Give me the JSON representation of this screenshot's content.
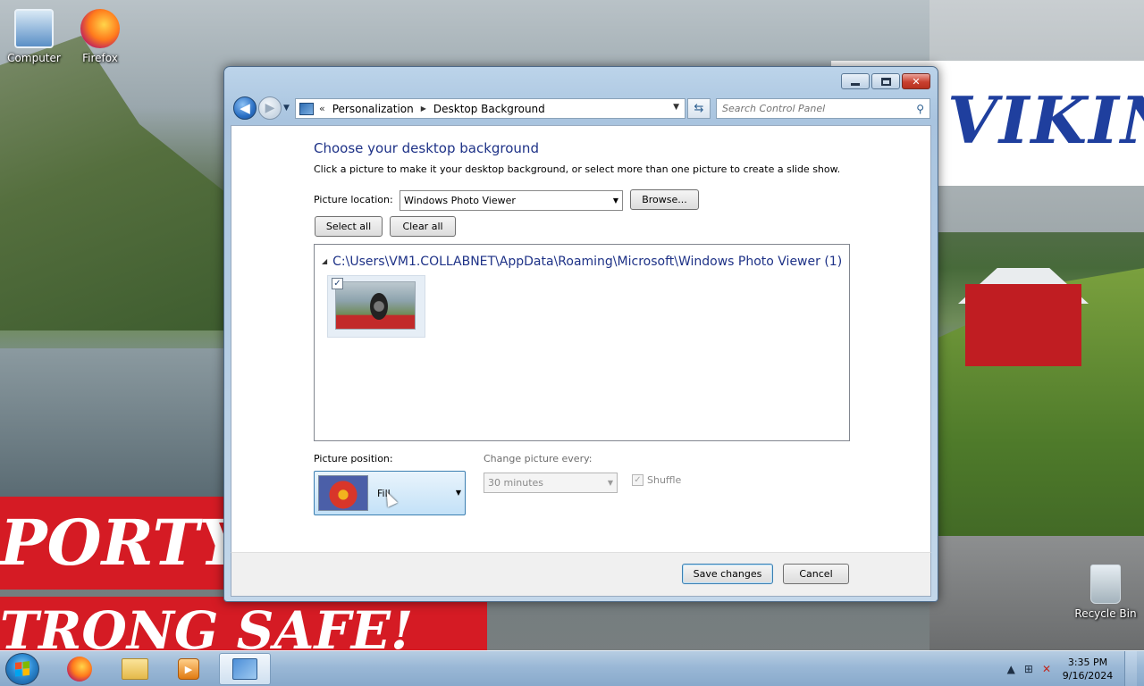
{
  "desktop": {
    "icons": [
      {
        "label": "Computer"
      },
      {
        "label": "Firefox"
      },
      {
        "label": "Recycle Bin"
      }
    ],
    "wallpaper_text": {
      "brand": "VIKING",
      "banner_line_1": "PORTY",
      "banner_line_2": "TRONG  SAFE!"
    }
  },
  "window": {
    "controls": {
      "minimize": "minimize",
      "maximize": "maximize",
      "close": "✕"
    },
    "nav": {
      "back_glyph": "◀",
      "forward_glyph": "▶",
      "recent_glyph": "▼",
      "address_sep": "«",
      "breadcrumbs": [
        "Personalization",
        "Desktop Background"
      ],
      "crumb_arrow": "▶",
      "address_dropdown": "▼",
      "refresh_glyph": "⇆",
      "search_placeholder": "Search Control Panel",
      "search_glyph": "⚲"
    },
    "content": {
      "title": "Choose your desktop background",
      "subtitle": "Click a picture to make it your desktop background, or select more than one picture to create a slide show.",
      "picture_location_label": "Picture location:",
      "picture_location_value": "Windows Photo Viewer",
      "browse_label": "Browse...",
      "select_all_label": "Select all",
      "clear_all_label": "Clear all",
      "gallery": {
        "group_toggle": "◢",
        "group_header": "C:\\Users\\VM1.COLLABNET\\AppData\\Roaming\\Microsoft\\Windows Photo Viewer (1)",
        "items": [
          {
            "checked": true,
            "check_glyph": "✓"
          }
        ]
      },
      "picture_position_label": "Picture position:",
      "picture_position_value": "Fill",
      "change_every_label": "Change picture every:",
      "change_every_value": "30 minutes",
      "shuffle_label": "Shuffle",
      "shuffle_checked_glyph": "✓"
    },
    "footer": {
      "save_label": "Save changes",
      "cancel_label": "Cancel"
    }
  },
  "taskbar": {
    "media_glyph": "▶",
    "tray": {
      "arrow": "▲",
      "network_glyph": "⊞",
      "volume_glyph": "✕",
      "time": "3:35 PM",
      "date": "9/16/2024"
    }
  },
  "colors": {
    "title_blue": "#1e3287",
    "taskbar": "#9ab8d6",
    "close_red": "#c9402f"
  }
}
